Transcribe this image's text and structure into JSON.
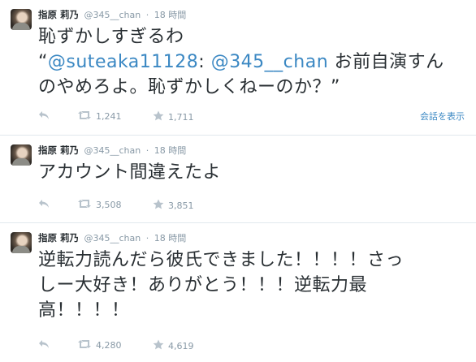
{
  "tweets": [
    {
      "author": "指原 莉乃",
      "handle": "@345__chan",
      "time": "18 時間",
      "lines": [
        {
          "parts": [
            {
              "t": "恥ずかしすぎるわ"
            }
          ]
        },
        {
          "parts": [
            {
              "t": "“"
            },
            {
              "t": "@suteaka11128",
              "mention": true
            },
            {
              "t": ": "
            },
            {
              "t": "@345__chan",
              "mention": true
            },
            {
              "t": " お前自演すん"
            }
          ]
        },
        {
          "parts": [
            {
              "t": "のやめろよ。恥ずかしくねーのか？”"
            }
          ]
        }
      ],
      "retweets": "1,241",
      "favorites": "1,711",
      "conversation": "会話を表示"
    },
    {
      "author": "指原 莉乃",
      "handle": "@345__chan",
      "time": "18 時間",
      "lines": [
        {
          "parts": [
            {
              "t": "アカウント間違えたよ"
            }
          ]
        }
      ],
      "retweets": "3,508",
      "favorites": "3,851"
    },
    {
      "author": "指原 莉乃",
      "handle": "@345__chan",
      "time": "18 時間",
      "lines": [
        {
          "parts": [
            {
              "t": "逆転力読んだら彼氏できました！！！！さっ"
            }
          ]
        },
        {
          "parts": [
            {
              "t": "しー大好き！ありがとう！！！逆転力最"
            }
          ]
        },
        {
          "parts": [
            {
              "t": "高！！！！"
            }
          ]
        }
      ],
      "retweets": "4,280",
      "favorites": "4,619"
    }
  ],
  "icons": {
    "reply": "reply-icon",
    "retweet": "retweet-icon",
    "favorite": "star-icon"
  },
  "colors": {
    "text": "#292f33",
    "muted": "#8899a6",
    "link": "#3b88c3",
    "divider": "#e1e8ed"
  }
}
